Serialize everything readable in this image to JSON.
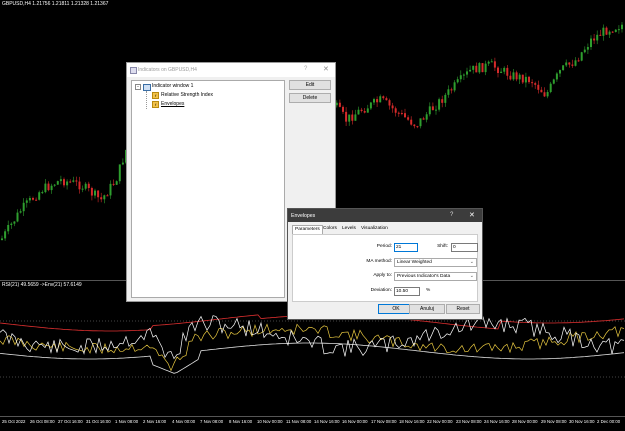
{
  "chart": {
    "header": "GBPUSD,H4  1.21756 1.21811 1.21328 1.21367",
    "indicator_header": "RSI(21) 49.5659  ->Env(21) 57.6149",
    "x_labels": [
      "25 Oct 2022",
      "26 Oct 08:00",
      "27 Oct 16:00",
      "31 Oct 16:00",
      "1 Nov 08:00",
      "2 Nov 16:00",
      "4 Nov 00:00",
      "7 Nov 08:00",
      "8 Nov 16:00",
      "10 Nov 00:00",
      "11 Nov 08:00",
      "14 Nov 16:00",
      "16 Nov 00:00",
      "17 Nov 08:00",
      "18 Nov 16:00",
      "22 Nov 00:00",
      "23 Nov 08:00",
      "24 Nov 16:00",
      "28 Nov 00:00",
      "29 Nov 08:00",
      "30 Nov 16:00",
      "2 Dec 00:00"
    ],
    "colors": {
      "bull": "#2e9e2e",
      "bear": "#d62a2a",
      "rsi": "#ffffff",
      "env_upper": "#e03030",
      "env_lower": "#e0e0e0",
      "env_mid": "#e8c840"
    }
  },
  "indicators_dialog": {
    "title": "Indicators on GBPUSD,H4",
    "help": "?",
    "close": "✕",
    "tree": {
      "root": "Indicator window 1",
      "items": [
        "Relative Strength Index",
        "Envelopes"
      ]
    },
    "edit": "Edit",
    "delete": "Delete"
  },
  "envelopes_dialog": {
    "title": "Envelopes",
    "help": "?",
    "close": "✕",
    "tabs": [
      "Parameters",
      "Colors",
      "Levels",
      "Visualization"
    ],
    "period_label": "Period:",
    "period_value": "21",
    "shift_label": "Shift:",
    "shift_value": "0",
    "ma_method_label": "MA method:",
    "ma_method_value": "Linear Weighted",
    "apply_to_label": "Apply to:",
    "apply_to_value": "Previous Indicator's Data",
    "deviation_label": "Deviation:",
    "deviation_value": "10.50",
    "deviation_unit": "%",
    "ok": "OK",
    "cancel": "Anuluj",
    "reset": "Reset"
  }
}
